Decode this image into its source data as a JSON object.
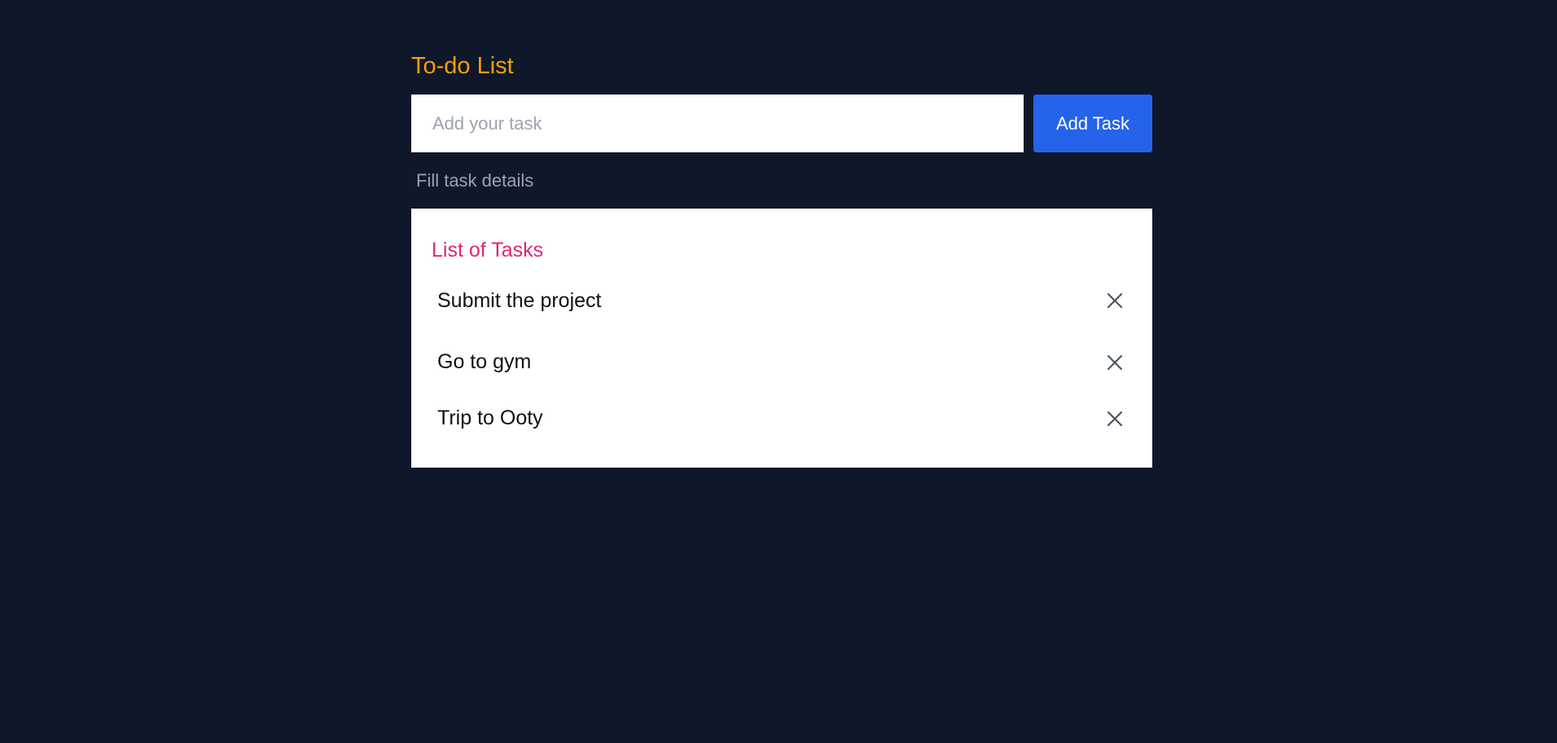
{
  "app": {
    "title": "To-do List"
  },
  "form": {
    "input_placeholder": "Add your task",
    "input_value": "",
    "add_button_label": "Add Task",
    "hint": "Fill task details"
  },
  "list": {
    "title": "List of Tasks",
    "items": [
      {
        "text": "Submit the project",
        "delete_icon": "close-icon"
      },
      {
        "text": "Go to gym",
        "delete_icon": "close-icon"
      },
      {
        "text": "Trip to Ooty",
        "delete_icon": "close-icon"
      }
    ]
  },
  "colors": {
    "background": "#0f172a",
    "title": "#f59e0b",
    "accent_button": "#2563eb",
    "list_title": "#db2777",
    "hint": "#9ca3af"
  }
}
